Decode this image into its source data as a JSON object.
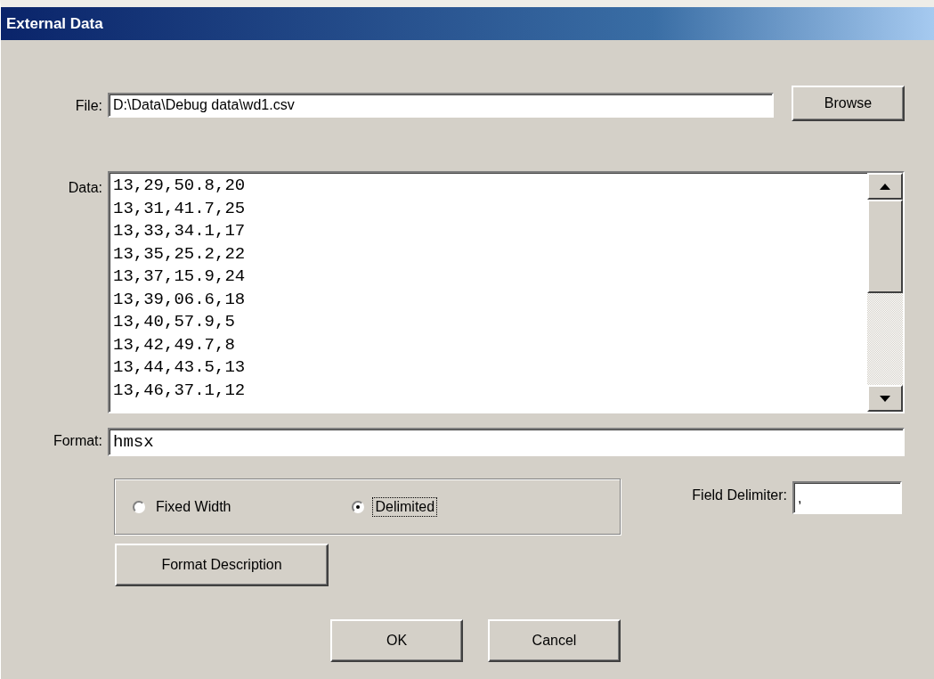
{
  "window": {
    "title": "External Data"
  },
  "file": {
    "label": "File:",
    "value": "D:\\Data\\Debug data\\wd1.csv",
    "button": "Browse"
  },
  "data": {
    "label": "Data:",
    "lines": [
      "13,29,50.8,20",
      "13,31,41.7,25",
      "13,33,34.1,17",
      "13,35,25.2,22",
      "13,37,15.9,24",
      "13,39,06.6,18",
      "13,40,57.9,5",
      "13,42,49.7,8",
      "13,44,43.5,13",
      "13,46,37.1,12"
    ]
  },
  "format": {
    "label": "Format:",
    "value": "hmsx"
  },
  "mode": [
    {
      "label": "Fixed Width",
      "selected": false,
      "focused": false
    },
    {
      "label": "Delimited",
      "selected": true,
      "focused": true
    }
  ],
  "delimiter": {
    "label": "Field Delimiter:",
    "value": ","
  },
  "format_description_button": "Format Description",
  "buttons": [
    "OK",
    "Cancel"
  ]
}
